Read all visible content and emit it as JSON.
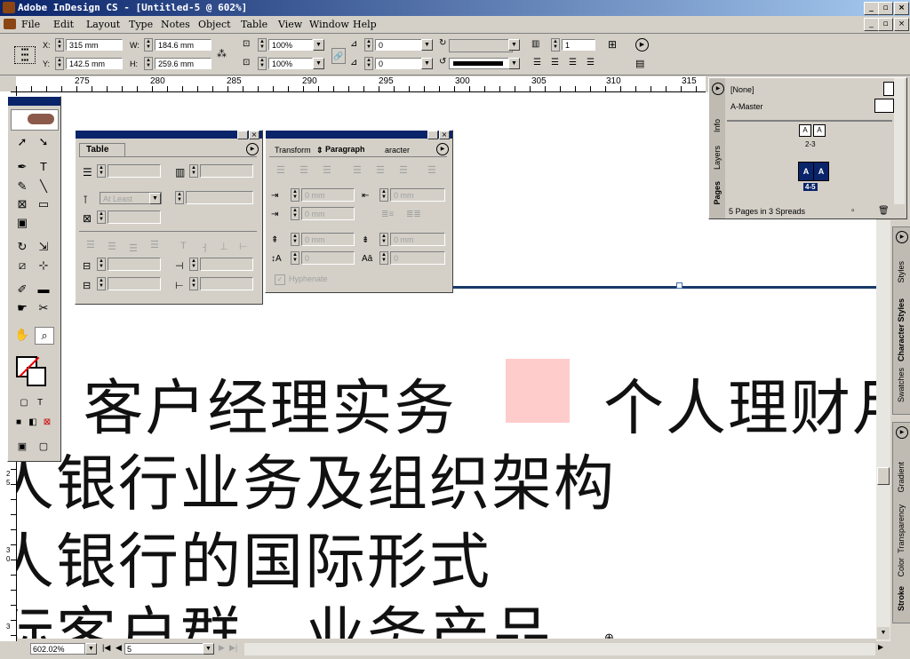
{
  "window": {
    "title": "Adobe InDesign CS - [Untitled-5 @ 602%]",
    "minimize_label": "_",
    "restore_label": "▫",
    "close_label": "×"
  },
  "menu": {
    "items": [
      "File",
      "Edit",
      "Layout",
      "Type",
      "Notes",
      "Object",
      "Table",
      "View",
      "Window",
      "Help"
    ]
  },
  "control": {
    "x_label": "X:",
    "x_value": "315 mm",
    "y_label": "Y:",
    "y_value": "142.5 mm",
    "w_label": "W:",
    "w_value": "184.6 mm",
    "h_label": "H:",
    "h_value": "259.6 mm",
    "scale_x": "100%",
    "scale_y": "100%",
    "rotate": "0",
    "shear": "0",
    "stroke_weight": "1"
  },
  "ruler": {
    "h_ticks": [
      "275",
      "280",
      "285",
      "290",
      "295",
      "300",
      "305",
      "310",
      "315"
    ],
    "v_ticks": [
      "2",
      "5",
      "3",
      "0",
      "3"
    ]
  },
  "table_panel": {
    "tab": "Table",
    "row_height_mode": "At Least"
  },
  "paragraph_panel": {
    "tabs": [
      "Transform",
      "Paragraph",
      "aracter"
    ],
    "left_indent": "0 mm",
    "right_indent": "0 mm",
    "first_indent": "0 mm",
    "last_indent": "0 mm",
    "space_before": "0 mm",
    "space_after": "0 mm",
    "drop_lines": "0",
    "drop_chars": "0",
    "hyphenate_label": "Hyphenate"
  },
  "pages_panel": {
    "tabs": [
      "Pages",
      "Layers",
      "Info"
    ],
    "masters": [
      "[None]",
      "A-Master"
    ],
    "spread_label_1": "2-3",
    "spread_label_2": "4-5",
    "page_letter": "A",
    "status": "5 Pages in 3 Spreads"
  },
  "side_panels": {
    "group1": [
      "Swatches",
      "Character Styles",
      "Styles"
    ],
    "group2": [
      "Stroke",
      "Color",
      "Transparency",
      "Gradient"
    ]
  },
  "document_text": {
    "line1_left": ": 客户经理实务",
    "line1_right": "个人理财月",
    "line2": "人银行业务及组织架构",
    "line3": "人银行的国际形式",
    "line4": "际客户群、业务产品"
  },
  "status_bar": {
    "zoom": "602.02%",
    "page": "5"
  },
  "colors": {
    "title_start": "#0a246a",
    "title_end": "#a6caf0",
    "highlight_box": "#ffcccc",
    "page_icon": "#0a246a"
  }
}
